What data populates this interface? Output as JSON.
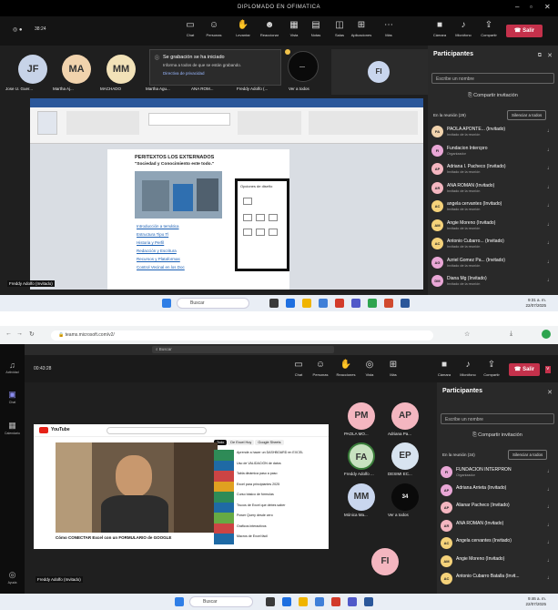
{
  "window_title": "DIPLOMADO EN OFIMATICA",
  "top_call": {
    "meeting_time": "38:24",
    "toolbar": [
      {
        "label": "Cámara",
        "icon": "camera-icon"
      },
      {
        "label": "Micrófono",
        "icon": "mic-icon"
      },
      {
        "label": "Compartir",
        "icon": "share-icon"
      }
    ],
    "leave_label": "Salir",
    "notice_title": "Se grabación se ha iniciado",
    "notice_text": "Informa a todos de que se están grabando.",
    "notice_link": "Directiva de privacidad",
    "see_all": "Ver a todos",
    "avatars": [
      {
        "initials": "JF",
        "color": "#c7d3e8"
      },
      {
        "initials": "MA",
        "color": "#f1d3ad"
      },
      {
        "initials": "MM",
        "color": "#f2e2b8"
      },
      {
        "initials": "FI",
        "color": "#c9d6ee"
      }
    ],
    "name_labels": [
      "Jose U. Guer...",
      "Martha Aj...",
      "MACHADO",
      "Martha Agu...",
      "ANA ROM...",
      "Freddy Adolfo (..."
    ],
    "shared_name": "Freddy Adolfo (Invitado)",
    "participants": {
      "title": "Participantes",
      "search_placeholder": "Escribe un nombre",
      "invite_label": "Compartir invitación",
      "section_label": "En la reunión (29)",
      "mute_all": "Silenciar a todos",
      "people": [
        {
          "initials": "PA",
          "name": "PAOLA APONTE... (Invitado)",
          "role": "Invitado de la reunión",
          "color": "#f1d3ad"
        },
        {
          "initials": "FI",
          "name": "Fundacion Intercpro",
          "role": "Organizador",
          "color": "#e9a7d6"
        },
        {
          "initials": "AP",
          "name": "Adriana I. Pacheco (Invitado)",
          "role": "Invitado de la reunión",
          "color": "#f4b6c0"
        },
        {
          "initials": "AR",
          "name": "ANA ROMAN (Invitado)",
          "role": "Invitado de la reunión",
          "color": "#f4b6c0"
        },
        {
          "initials": "AC",
          "name": "angela cervantes (Invitado)",
          "role": "Invitado de la reunión",
          "color": "#f5d27a"
        },
        {
          "initials": "AM",
          "name": "Angie Moreno (Invitado)",
          "role": "Invitado de la reunión",
          "color": "#f5d27a"
        },
        {
          "initials": "AC",
          "name": "Antonio Cubarro... (Invitado)",
          "role": "Invitado de la reunión",
          "color": "#f5d27a"
        },
        {
          "initials": "AG",
          "name": "Azriel Gomez Pa... (Invitado)",
          "role": "Invitado de la reunión",
          "color": "#e9a7d6"
        },
        {
          "initials": "DM",
          "name": "Diana Mg (Invitado)",
          "role": "Invitado de la reunión",
          "color": "#e9a7d6"
        }
      ]
    },
    "word": {
      "doc_title": "PERITEXTOS LOS EXTERNADOS",
      "doc_subtitle": "\"Sociedad y Conocimiento este todo.\"",
      "links": [
        "Introducción a temática",
        "Estructura Tipo Tl",
        "Historia y Perfil",
        "Redacción y Escritura",
        "Recursos y Plataformas",
        "Control Vecinal en los Doc"
      ],
      "pane_title": "Opciones de diseño"
    },
    "taskbar": {
      "search": "Buscar",
      "time": "9:31 a. m.",
      "date": "22/07/2025"
    }
  },
  "bottom_call": {
    "url": "teams.microsoft.com/v2/",
    "rail": [
      "Actividad",
      "Chat",
      "Calendario",
      "Ayuda"
    ],
    "meeting_time": "00:43:28",
    "toolbar": [
      {
        "label": "Chat",
        "icon": "chat-icon"
      },
      {
        "label": "Personas",
        "icon": "people-icon"
      },
      {
        "label": "Reacciones",
        "icon": "hand-icon"
      },
      {
        "label": "Vista",
        "icon": "view-icon"
      },
      {
        "label": "Más",
        "icon": "more-icon"
      },
      {
        "label": "Cámara",
        "icon": "camera-icon"
      },
      {
        "label": "Micrófono",
        "icon": "mic-icon"
      },
      {
        "label": "Compartir",
        "icon": "share-icon"
      }
    ],
    "leave_label": "Salir",
    "avatars": [
      {
        "initials": "PM",
        "label": "PAOLA MO...",
        "color": "#f4b6c0"
      },
      {
        "initials": "AP",
        "label": "Adriana Pa...",
        "color": "#f4b6c0"
      },
      {
        "initials": "FA",
        "label": "Freddy Adolfo ...",
        "color": "#c8e2c0"
      },
      {
        "initials": "EP",
        "label": "DESIMI EC...",
        "color": "#d8e4f0"
      },
      {
        "initials": "MM",
        "label": "Mónica Ma...",
        "color": "#c9d6ee"
      },
      {
        "initials": "34",
        "label": "Ver a todos",
        "color": "#0a0a0a"
      },
      {
        "initials": "FI",
        "label": "",
        "color": "#f4b6c0"
      }
    ],
    "shared_name": "Freddy Adolfo (Invitado)",
    "participants": {
      "title": "Participantes",
      "search_placeholder": "Escribe un nombre",
      "invite_label": "Compartir invitación",
      "section_label": "En la reunión (34)",
      "mute_all": "Silenciar a todos",
      "people": [
        {
          "initials": "FI",
          "name": "FUNDACION INTERPRON",
          "role": "Organizador",
          "color": "#e9a7d6"
        },
        {
          "initials": "AP",
          "name": "Adriana Arrieta (Invitado)",
          "role": "",
          "color": "#e9a7d6"
        },
        {
          "initials": "AP",
          "name": "Alianar Pacheco (Invitado)",
          "role": "",
          "color": "#f4b6c0"
        },
        {
          "initials": "AR",
          "name": "ANA ROMAN (Invitado)",
          "role": "",
          "color": "#f4b6c0"
        },
        {
          "initials": "AC",
          "name": "Angela cervantes (Invitado)",
          "role": "",
          "color": "#f5d27a"
        },
        {
          "initials": "AM",
          "name": "Angie Moreno (Invitado)",
          "role": "",
          "color": "#f5d27a"
        },
        {
          "initials": "AC",
          "name": "Antonio Cubarro Batalla (Invit...",
          "role": "",
          "color": "#f5d27a"
        }
      ]
    },
    "youtube": {
      "brand": "YouTube",
      "video_title": "Cómo CONECTAR Excel con un FORMULARIO de GOOGLE",
      "chips": [
        "Todo",
        "De Excel Hoy",
        "Google Sheets"
      ],
      "suggestions": [
        "Aprende a hacer un DASHBOARD en EXCEL",
        "Uso de VALIDACIÓN de datos",
        "Tabla dinámica paso a paso",
        "Excel para principiantes 2025",
        "Curso básico de fórmulas",
        "Trucos de Excel que debes saber",
        "Power Query desde cero",
        "Gráficos interactivos",
        "Macros de Excel fácil"
      ]
    },
    "taskbar": {
      "search": "Buscar",
      "time": "9:46 a. m.",
      "date": "22/07/2025"
    }
  }
}
